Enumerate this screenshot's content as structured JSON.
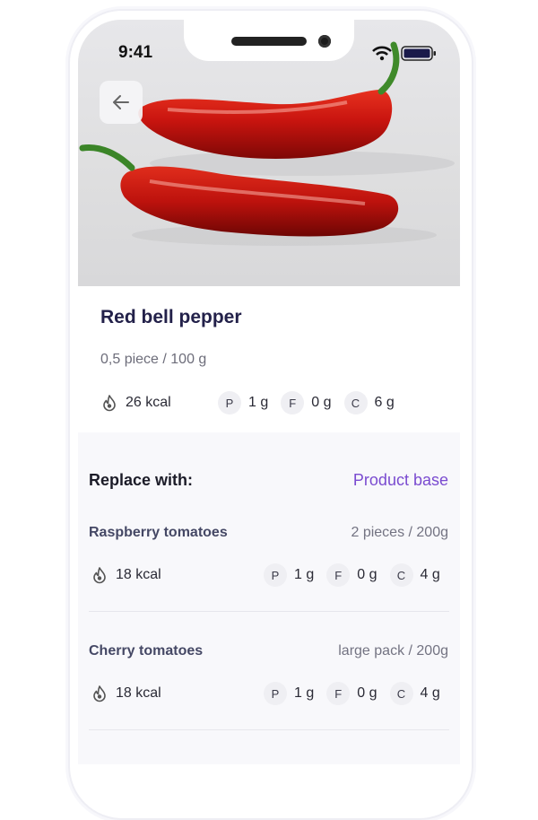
{
  "status_bar": {
    "time": "9:41"
  },
  "product": {
    "name": "Red bell pepper",
    "portion": "0,5 piece / 100 g",
    "kcal": "26 kcal",
    "macros": [
      {
        "badge": "P",
        "value": "1 g"
      },
      {
        "badge": "F",
        "value": "0 g"
      },
      {
        "badge": "C",
        "value": "6 g"
      }
    ]
  },
  "replace_section": {
    "title": "Replace with:",
    "link_label": "Product base",
    "items": [
      {
        "name": "Raspberry tomatoes",
        "portion": "2 pieces / 200g",
        "kcal": "18 kcal",
        "macros": [
          {
            "badge": "P",
            "value": "1 g"
          },
          {
            "badge": "F",
            "value": "0 g"
          },
          {
            "badge": "C",
            "value": "4 g"
          }
        ]
      },
      {
        "name": "Cherry tomatoes",
        "portion": "large pack / 200g",
        "kcal": "18 kcal",
        "macros": [
          {
            "badge": "P",
            "value": "1 g"
          },
          {
            "badge": "F",
            "value": "0 g"
          },
          {
            "badge": "C",
            "value": "4 g"
          }
        ]
      }
    ]
  },
  "icons": {
    "back": "arrow-left-icon",
    "kcal": "flame-icon",
    "wifi": "wifi-icon",
    "battery": "battery-icon"
  },
  "colors": {
    "title": "#23214a",
    "accent_link": "#7a4bd0",
    "pepper": "#c8140f"
  }
}
